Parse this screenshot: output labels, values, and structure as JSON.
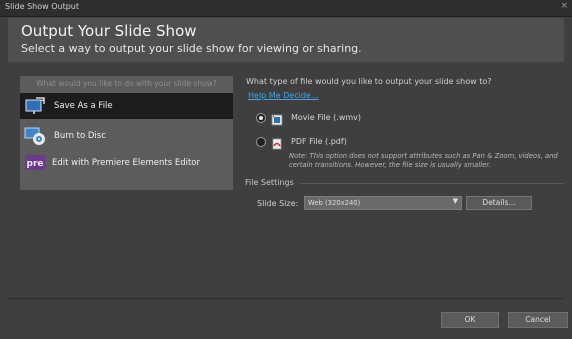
{
  "window": {
    "title": "Slide Show Output"
  },
  "header": {
    "title": "Output Your Slide Show",
    "subtitle": "Select a way to output your slide show for viewing or sharing."
  },
  "left_panel": {
    "header": "What would you like to do with your slide show?",
    "items": [
      {
        "label": "Save As a File",
        "icon": "monitor-save-icon",
        "selected": true
      },
      {
        "label": "Burn to Disc",
        "icon": "disc-icon",
        "selected": false
      },
      {
        "label": "Edit with Premiere Elements Editor",
        "icon": "premiere-icon",
        "selected": false
      }
    ]
  },
  "file_type": {
    "question": "What type of file would you like to output your slide show to?",
    "help_link": "Help Me Decide...",
    "options": [
      {
        "label": "Movie File (.wmv)",
        "icon": "movie-file-icon",
        "selected": true
      },
      {
        "label": "PDF File (.pdf)",
        "icon": "pdf-file-icon",
        "selected": false
      }
    ],
    "note": "Note: This option does not support attributes such as Pan & Zoom, videos, and certain transitions. However, the file size is usually smaller."
  },
  "file_settings": {
    "heading": "File Settings",
    "slide_size_label": "Slide Size:",
    "slide_size_value": "Web (320x240)",
    "details_button": "Details..."
  },
  "footer": {
    "ok_label": "OK",
    "cancel_label": "Cancel"
  },
  "colors": {
    "background": "#3f3f3f",
    "header": "#4f4f4f",
    "panel": "#5c5c5c",
    "selected": "#1c1c1c",
    "link": "#41a6e8"
  }
}
